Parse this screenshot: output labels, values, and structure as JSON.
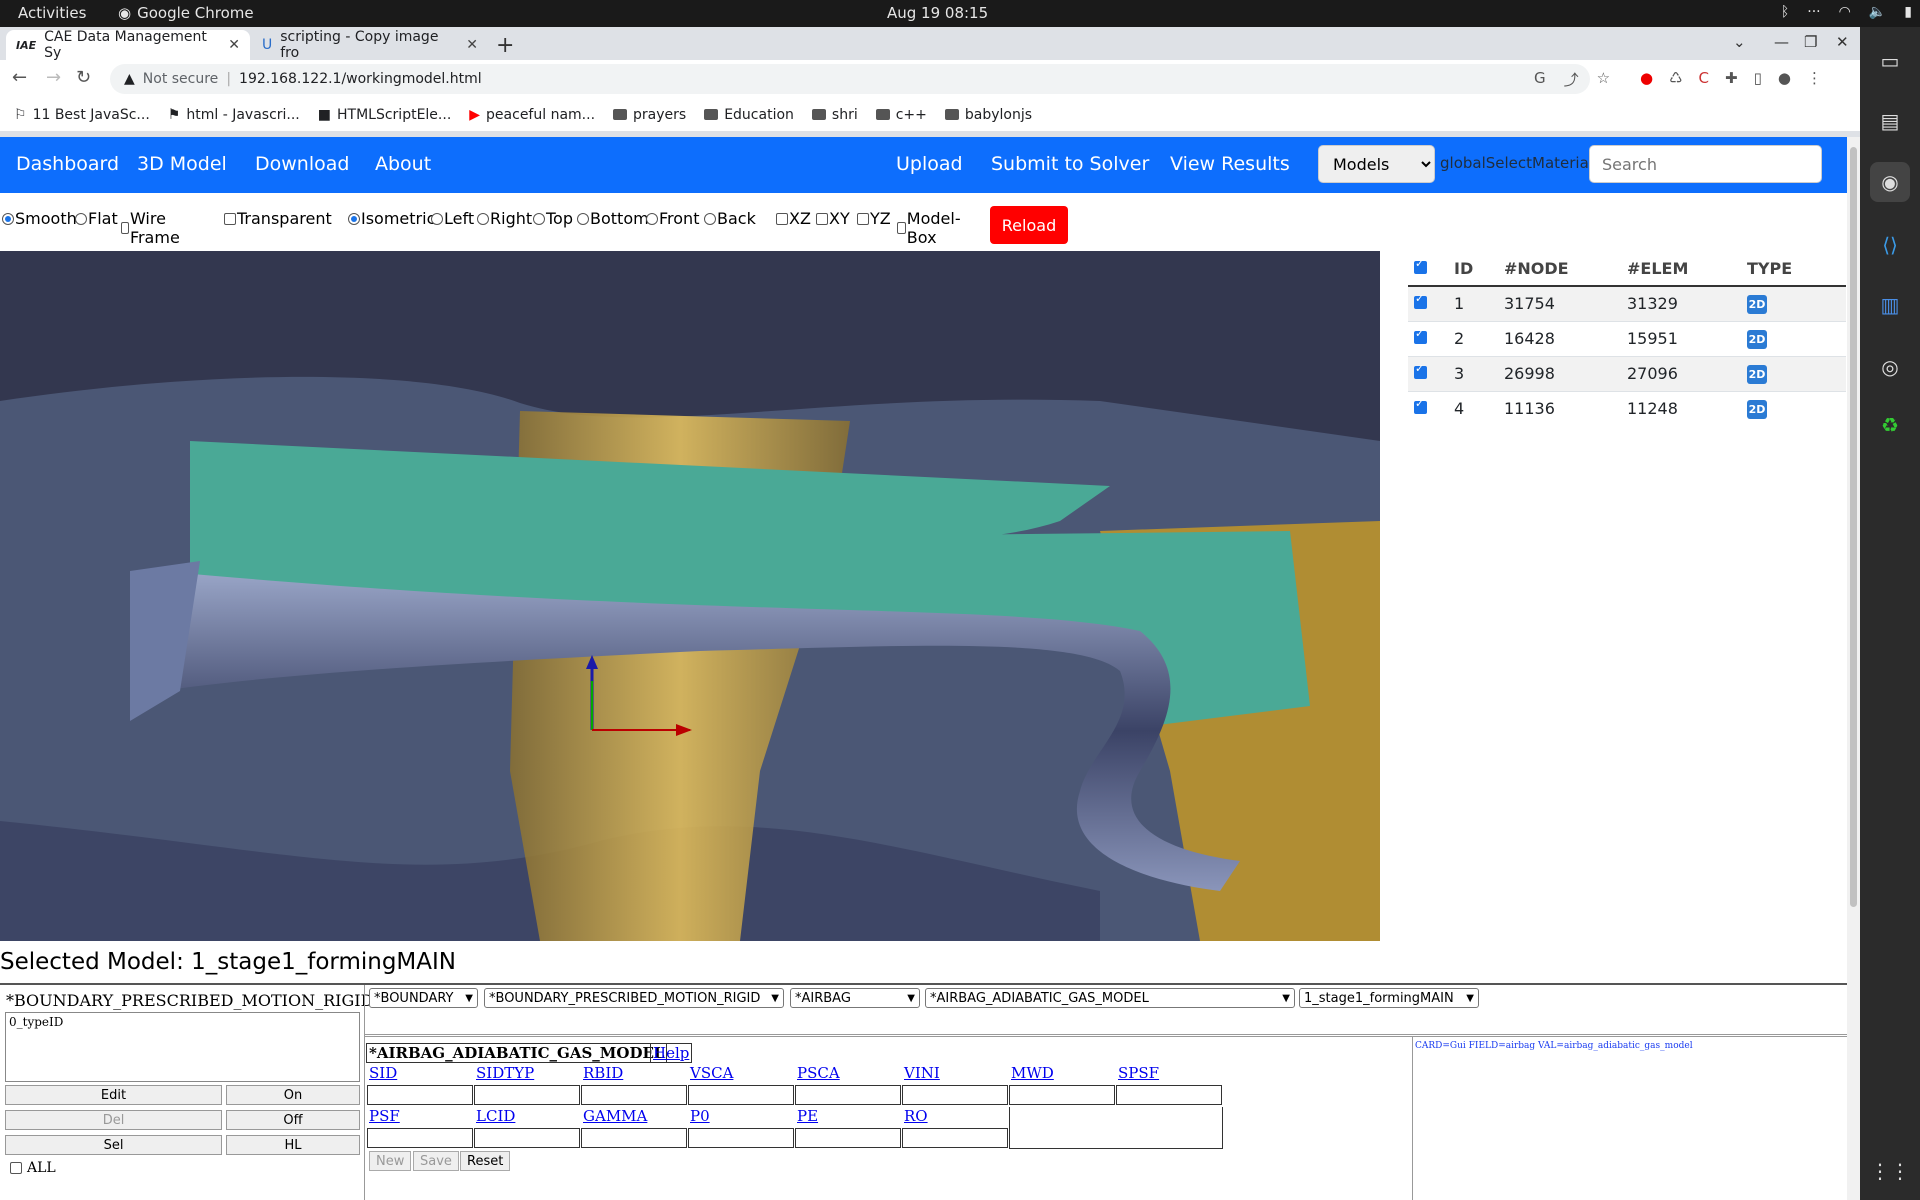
{
  "os": {
    "activities": "Activities",
    "app_name": "Google Chrome",
    "clock": "Aug 19  08:15"
  },
  "browser": {
    "tabs": [
      {
        "title": "CAE Data Management Sy",
        "icon": "iae-favicon"
      },
      {
        "title": "scripting - Copy image fro",
        "icon": "superuser-favicon"
      }
    ],
    "url_security": "Not secure",
    "url": "192.168.122.1/workingmodel.html",
    "bookmarks": [
      "11 Best JavaSc...",
      "html - Javascri...",
      "HTMLScriptEle...",
      "peaceful nam...",
      "prayers",
      "Education",
      "shri",
      "c++",
      "babylonjs"
    ]
  },
  "navbar": {
    "left_links": [
      "Dashboard",
      "3D Model",
      "Download",
      "About"
    ],
    "right_links": [
      "Upload",
      "Submit to Solver",
      "View Results"
    ],
    "models_select": "Models",
    "global_select_material": "globalSelectMaterial",
    "search_placeholder": "Search",
    "color": "#0d6efd"
  },
  "render_options": {
    "shading": [
      {
        "label": "Smooth",
        "checked": true,
        "type": "radio"
      },
      {
        "label": "Flat",
        "checked": false,
        "type": "radio"
      },
      {
        "label": "Wire Frame",
        "checked": false,
        "type": "checkbox"
      },
      {
        "label": "Transparent",
        "checked": false,
        "type": "checkbox"
      }
    ],
    "views": [
      {
        "label": "Isometric",
        "checked": true
      },
      {
        "label": "Left",
        "checked": false
      },
      {
        "label": "Right",
        "checked": false
      },
      {
        "label": "Top",
        "checked": false
      },
      {
        "label": "Bottom",
        "checked": false
      },
      {
        "label": "Front",
        "checked": false
      },
      {
        "label": "Back",
        "checked": false
      }
    ],
    "planes": [
      "XZ",
      "XY",
      "YZ",
      "Model-Box"
    ],
    "reload": "Reload"
  },
  "parts_table": {
    "headers": [
      "ID",
      "#NODE",
      "#ELEM",
      "TYPE"
    ],
    "rows": [
      {
        "id": "1",
        "nodes": "31754",
        "elems": "31329",
        "type": "2D"
      },
      {
        "id": "2",
        "nodes": "16428",
        "elems": "15951",
        "type": "2D"
      },
      {
        "id": "3",
        "nodes": "26998",
        "elems": "27096",
        "type": "2D"
      },
      {
        "id": "4",
        "nodes": "11136",
        "elems": "11248",
        "type": "2D"
      }
    ]
  },
  "selected_model": "Selected Model: 1_stage1_formingMAIN",
  "keyword_panel": {
    "title": "*BOUNDARY_PRESCRIBED_MOTION_RIGID",
    "list_item": "0_typeID",
    "buttons": [
      "Edit",
      "On",
      "Del",
      "Off",
      "Sel",
      "HL"
    ],
    "all_label": "ALL"
  },
  "selectors": [
    "*BOUNDARY",
    "*BOUNDARY_PRESCRIBED_MOTION_RIGID",
    "*AIRBAG",
    "*AIRBAG_ADIABATIC_GAS_MODEL",
    "1_stage1_formingMAIN"
  ],
  "card": {
    "title": "*AIRBAG_ADIABATIC_GAS_MODEL",
    "help": "Help",
    "row1": [
      "SID",
      "SIDTYP",
      "RBID",
      "VSCA",
      "PSCA",
      "VINI",
      "MWD",
      "SPSF"
    ],
    "row2": [
      "PSF",
      "LCID",
      "GAMMA",
      "P0",
      "PE",
      "RO"
    ],
    "info": "CARD=Gui FIELD=airbag VAL=airbag_adiabatic_gas_model",
    "actions": [
      "New",
      "Save",
      "Reset"
    ]
  }
}
